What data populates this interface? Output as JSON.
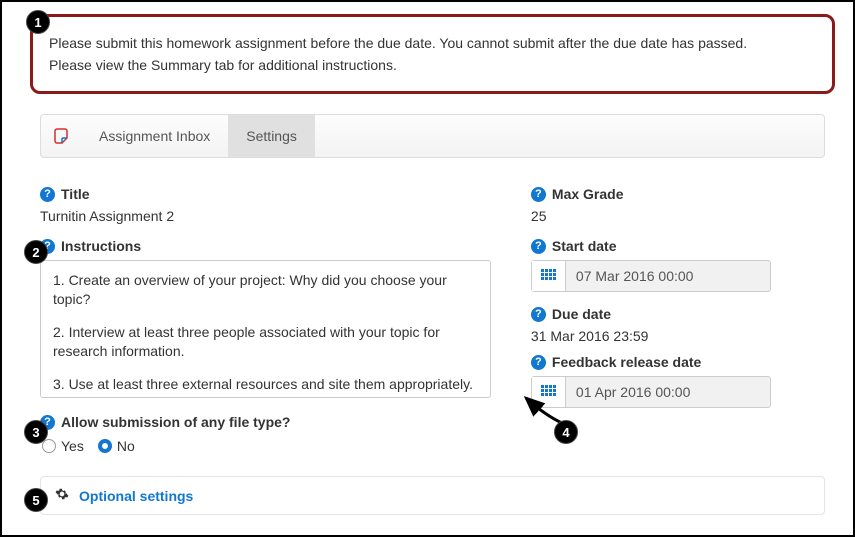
{
  "callout": {
    "line1": "Please submit this homework assignment before the due date. You cannot submit after the due date has passed.",
    "line2": "Please view the Summary tab for additional instructions."
  },
  "tabs": {
    "inbox": "Assignment Inbox",
    "settings": "Settings"
  },
  "left": {
    "title_label": "Title",
    "title_value": "Turnitin Assignment 2",
    "instructions_label": "Instructions",
    "instructions": {
      "p1": "1. Create an overview of your project: Why did you choose your topic?",
      "p2": "2. Interview at least three people associated with your topic for research information.",
      "p3": "3. Use at least three external resources and site them appropriately."
    },
    "allow_any_label": "Allow submission of any file type?",
    "yes": "Yes",
    "no": "No"
  },
  "right": {
    "max_grade_label": "Max Grade",
    "max_grade_value": "25",
    "start_date_label": "Start date",
    "start_date_value": "07 Mar 2016 00:00",
    "due_date_label": "Due date",
    "due_date_value": "31 Mar 2016 23:59",
    "feedback_label": "Feedback release date",
    "feedback_value": "01 Apr 2016 00:00"
  },
  "optional": {
    "label": "Optional settings"
  },
  "badges": {
    "b1": "1",
    "b2": "2",
    "b3": "3",
    "b4": "4",
    "b5": "5"
  }
}
